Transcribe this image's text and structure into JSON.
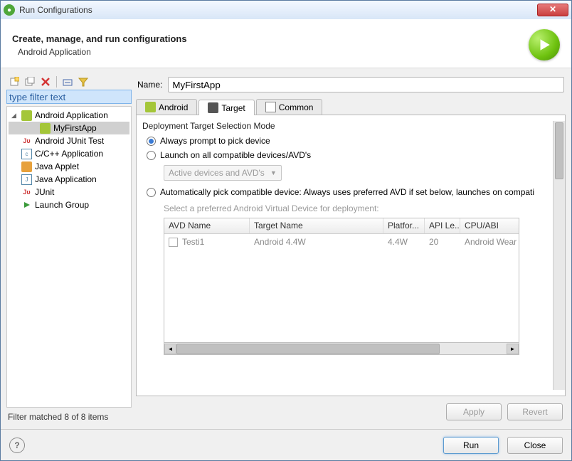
{
  "window": {
    "title": "Run Configurations",
    "close_glyph": "✕"
  },
  "header": {
    "title": "Create, manage, and run configurations",
    "subtitle": "Android Application"
  },
  "toolbar_icons": {
    "new": "new-config-icon",
    "duplicate": "duplicate-icon",
    "delete": "delete-icon",
    "collapse": "collapse-all-icon",
    "filter": "filter-icon"
  },
  "filter": {
    "placeholder": "type filter text"
  },
  "tree": [
    {
      "label": "Android Application",
      "icon": "android-icon",
      "expandable": true,
      "expanded": true,
      "children": [
        {
          "label": "MyFirstApp",
          "icon": "android-config-icon",
          "selected": true
        }
      ]
    },
    {
      "label": "Android JUnit Test",
      "icon": "junit-android-icon"
    },
    {
      "label": "C/C++ Application",
      "icon": "c-app-icon"
    },
    {
      "label": "Java Applet",
      "icon": "applet-icon"
    },
    {
      "label": "Java Application",
      "icon": "java-app-icon"
    },
    {
      "label": "JUnit",
      "icon": "junit-icon"
    },
    {
      "label": "Launch Group",
      "icon": "launch-group-icon"
    }
  ],
  "left_footer": "Filter matched 8 of 8 items",
  "name": {
    "label": "Name:",
    "value": "MyFirstApp"
  },
  "tabs": [
    {
      "id": "android",
      "label": "Android"
    },
    {
      "id": "target",
      "label": "Target",
      "active": true
    },
    {
      "id": "common",
      "label": "Common"
    }
  ],
  "target": {
    "group_title": "Deployment Target Selection Mode",
    "opt_prompt": "Always prompt to pick device",
    "opt_all": "Launch on all compatible devices/AVD's",
    "combo_devices": "Active devices and AVD's",
    "opt_auto": "Automatically pick compatible device: Always uses preferred AVD if set below, launches on compati",
    "avd_hint": "Select a preferred Android Virtual Device for deployment:",
    "columns": {
      "avd": "AVD Name",
      "target": "Target Name",
      "platform": "Platfor...",
      "api": "API Le...",
      "cpu": "CPU/ABI"
    },
    "rows": [
      {
        "avd": "Testi1",
        "target": "Android 4.4W",
        "platform": "4.4W",
        "api": "20",
        "cpu": "Android Wear ARM"
      }
    ]
  },
  "buttons": {
    "apply": "Apply",
    "revert": "Revert",
    "run": "Run",
    "close": "Close"
  }
}
